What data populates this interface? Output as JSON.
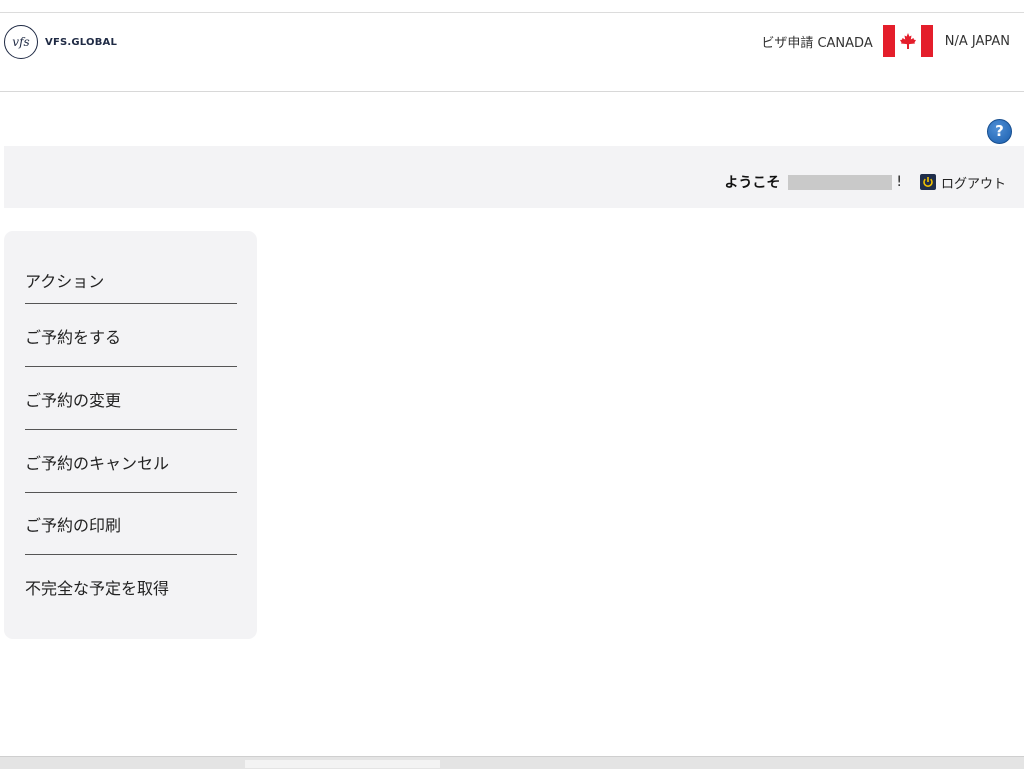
{
  "header": {
    "logo_mark": "vfs",
    "logo_text": "VFS.GLOBAL",
    "visa_label": "ビザ申請 CANADA",
    "country_label": "N/A JAPAN"
  },
  "welcome": {
    "label": "ようこそ",
    "exclaim": "!",
    "logout_label": "ログアウト"
  },
  "sidebar": {
    "items": [
      {
        "label": "アクション"
      },
      {
        "label": "ご予約をする"
      },
      {
        "label": "ご予約の変更"
      },
      {
        "label": "ご予約のキャンセル"
      },
      {
        "label": "ご予約の印刷"
      },
      {
        "label": "不完全な予定を取得"
      }
    ]
  },
  "icons": {
    "help": "?"
  },
  "colors": {
    "brand": "#1f2a44",
    "flag_red": "#e41e2b",
    "help_blue": "#1b5fae"
  }
}
